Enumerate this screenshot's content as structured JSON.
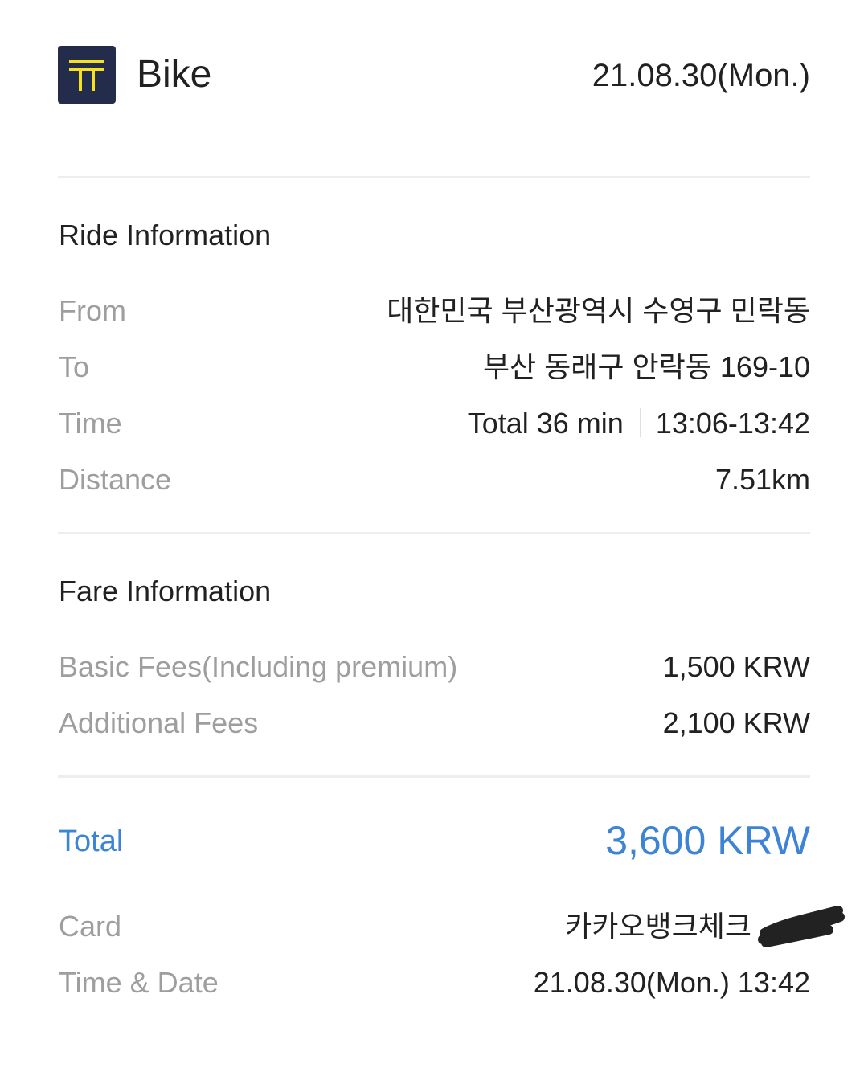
{
  "header": {
    "title": "Bike",
    "date": "21.08.30(Mon.)",
    "logo_icon": "t-logo-icon",
    "logo_bg": "#242c4c",
    "logo_fg": "#f7e11b"
  },
  "ride": {
    "section_title": "Ride Information",
    "from_label": "From",
    "from_value": "대한민국 부산광역시 수영구 민락동",
    "to_label": "To",
    "to_value": "부산 동래구 안락동 169-10",
    "time_label": "Time",
    "time_total": "Total 36 min",
    "time_range": "13:06-13:42",
    "distance_label": "Distance",
    "distance_value": "7.51km"
  },
  "fare": {
    "section_title": "Fare Information",
    "basic_label": "Basic Fees(Including premium)",
    "basic_value": "1,500 KRW",
    "additional_label": "Additional Fees",
    "additional_value": "2,100 KRW"
  },
  "total": {
    "label": "Total",
    "value": "3,600 KRW",
    "color": "#3d84d6"
  },
  "payment": {
    "card_label": "Card",
    "card_value": "카카오뱅크체크",
    "datetime_label": "Time & Date",
    "datetime_value": "21.08.30(Mon.) 13:42"
  }
}
